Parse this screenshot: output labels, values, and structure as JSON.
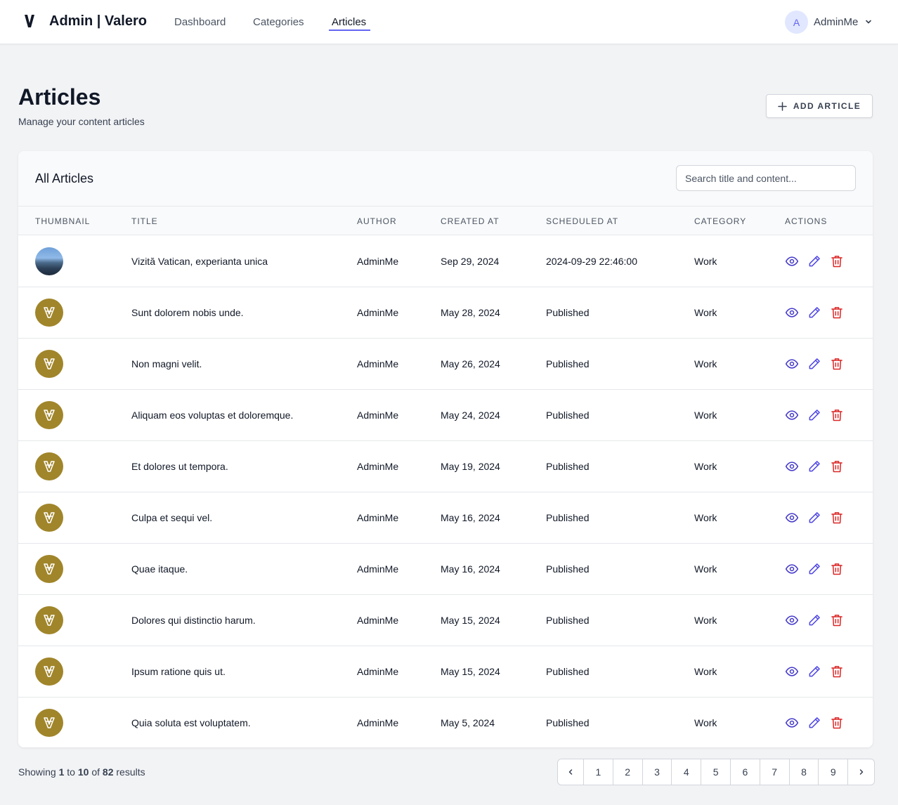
{
  "header": {
    "brand": "Admin | Valero",
    "nav": [
      {
        "label": "Dashboard",
        "active": false
      },
      {
        "label": "Categories",
        "active": false
      },
      {
        "label": "Articles",
        "active": true
      }
    ],
    "user": {
      "initial": "A",
      "name": "AdminMe"
    }
  },
  "page": {
    "title": "Articles",
    "subtitle": "Manage your content articles",
    "add_button": "ADD ARTICLE"
  },
  "table": {
    "card_title": "All Articles",
    "search_placeholder": "Search title and content...",
    "columns": [
      "THUMBNAIL",
      "TITLE",
      "AUTHOR",
      "CREATED AT",
      "SCHEDULED AT",
      "CATEGORY",
      "ACTIONS"
    ],
    "rows": [
      {
        "thumbnail": "photo",
        "title": "Vizită Vatican, experianta unica",
        "author": "AdminMe",
        "created_at": "Sep 29, 2024",
        "scheduled_at": "2024-09-29 22:46:00",
        "category": "Work"
      },
      {
        "thumbnail": "valero-logo",
        "title": "Sunt dolorem nobis unde.",
        "author": "AdminMe",
        "created_at": "May 28, 2024",
        "scheduled_at": "Published",
        "category": "Work"
      },
      {
        "thumbnail": "valero-logo",
        "title": "Non magni velit.",
        "author": "AdminMe",
        "created_at": "May 26, 2024",
        "scheduled_at": "Published",
        "category": "Work"
      },
      {
        "thumbnail": "valero-logo",
        "title": "Aliquam eos voluptas et doloremque.",
        "author": "AdminMe",
        "created_at": "May 24, 2024",
        "scheduled_at": "Published",
        "category": "Work"
      },
      {
        "thumbnail": "valero-logo",
        "title": "Et dolores ut tempora.",
        "author": "AdminMe",
        "created_at": "May 19, 2024",
        "scheduled_at": "Published",
        "category": "Work"
      },
      {
        "thumbnail": "valero-logo",
        "title": "Culpa et sequi vel.",
        "author": "AdminMe",
        "created_at": "May 16, 2024",
        "scheduled_at": "Published",
        "category": "Work"
      },
      {
        "thumbnail": "valero-logo",
        "title": "Quae itaque.",
        "author": "AdminMe",
        "created_at": "May 16, 2024",
        "scheduled_at": "Published",
        "category": "Work"
      },
      {
        "thumbnail": "valero-logo",
        "title": "Dolores qui distinctio harum.",
        "author": "AdminMe",
        "created_at": "May 15, 2024",
        "scheduled_at": "Published",
        "category": "Work"
      },
      {
        "thumbnail": "valero-logo",
        "title": "Ipsum ratione quis ut.",
        "author": "AdminMe",
        "created_at": "May 15, 2024",
        "scheduled_at": "Published",
        "category": "Work"
      },
      {
        "thumbnail": "valero-logo",
        "title": "Quia soluta est voluptatem.",
        "author": "AdminMe",
        "created_at": "May 5, 2024",
        "scheduled_at": "Published",
        "category": "Work"
      }
    ],
    "actions": [
      "view-icon",
      "edit-icon",
      "delete-icon"
    ]
  },
  "pagination": {
    "showing_prefix": "Showing",
    "from": "1",
    "to_word": "to",
    "to": "10",
    "of_word": "of",
    "total": "82",
    "results_word": "results",
    "pages": [
      "1",
      "2",
      "3",
      "4",
      "5",
      "6",
      "7",
      "8",
      "9"
    ]
  },
  "colors": {
    "accent": "#6366f1",
    "view_icon": "#4338ca",
    "edit_icon": "#4f46e5",
    "delete_icon": "#dc2626",
    "thumbnail_gold": "#a0852a",
    "page_background": "#f2f3f5"
  }
}
